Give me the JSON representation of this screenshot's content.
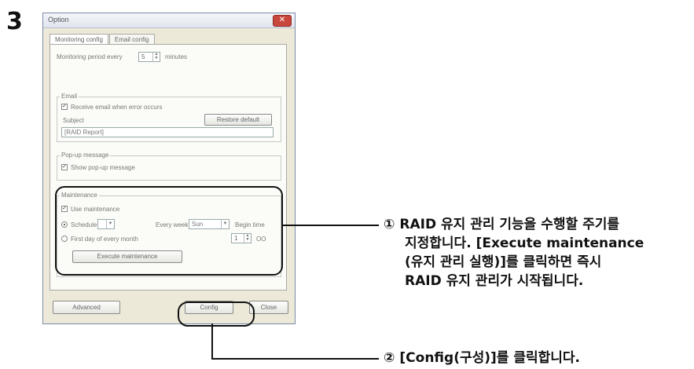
{
  "step_number": "3",
  "window": {
    "title": "Option",
    "close_glyph": "✕",
    "tabs": [
      "Monitoring config",
      "Email config"
    ],
    "monitoring": {
      "label": "Monitoring period every",
      "value": "5",
      "unit": "minutes"
    },
    "email": {
      "group_label": "Email",
      "receive_label": "Receive email when error occurs",
      "subject_label": "Subject",
      "restore_button": "Restore default",
      "subject_value": "[RAID Report]"
    },
    "popup": {
      "group_label": "Pop-up message",
      "show_label": "Show pop-up message"
    },
    "maintenance": {
      "group_label": "Maintenance",
      "use_label": "Use maintenance",
      "schedule_label": "Schedule",
      "schedule_value": "",
      "every_week_label": "Every week",
      "day_value": "Sun",
      "begin_time_label": "Begin time",
      "first_day_label": "First day of every month",
      "hour_value": "1",
      "hour_unit": "OO",
      "execute_button": "Execute maintenance"
    },
    "buttons": {
      "advanced": "Advanced",
      "config": "Config",
      "close": "Close"
    }
  },
  "annotations": [
    {
      "num": "①",
      "lines": [
        "RAID 유지 관리 기능을 수행할 주기를",
        "지정합니다. [Execute maintenance",
        "(유지 관리 실행)]를 클릭하면 즉시",
        "RAID 유지 관리가 시작됩니다."
      ]
    },
    {
      "num": "②",
      "lines": [
        "[Config(구성)]를 클릭합니다."
      ]
    }
  ]
}
